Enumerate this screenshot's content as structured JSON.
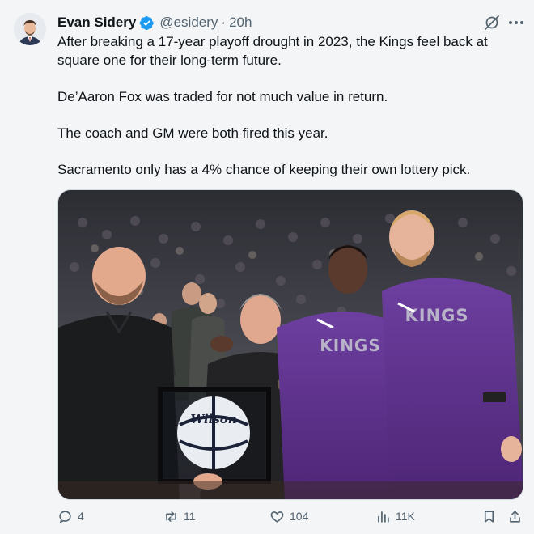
{
  "author": {
    "display_name": "Evan Sidery",
    "handle": "@esidery",
    "separator": "·",
    "timestamp": "20h",
    "avatar_icon": "avatar-man-suit"
  },
  "text": {
    "p1": "After breaking a 17-year playoff drought in 2023, the Kings feel back at square one for their long-term future.",
    "p2": "De’Aaron Fox was traded for not much value in return.",
    "p3": "The coach and GM were both fired this year.",
    "p4": "Sacramento only has a 4% chance of keeping their own lottery pick."
  },
  "media": {
    "jersey_text_left": "KINGS",
    "jersey_text_right": "KINGS",
    "ball_brand": "Wilson"
  },
  "actions": {
    "replies": "4",
    "reposts": "11",
    "likes": "104",
    "views": "11K"
  },
  "colors": {
    "verified_blue": "#1d9bf0",
    "kings_purple": "#5a2d81",
    "text_primary": "#0f1419",
    "text_secondary": "#536471"
  }
}
